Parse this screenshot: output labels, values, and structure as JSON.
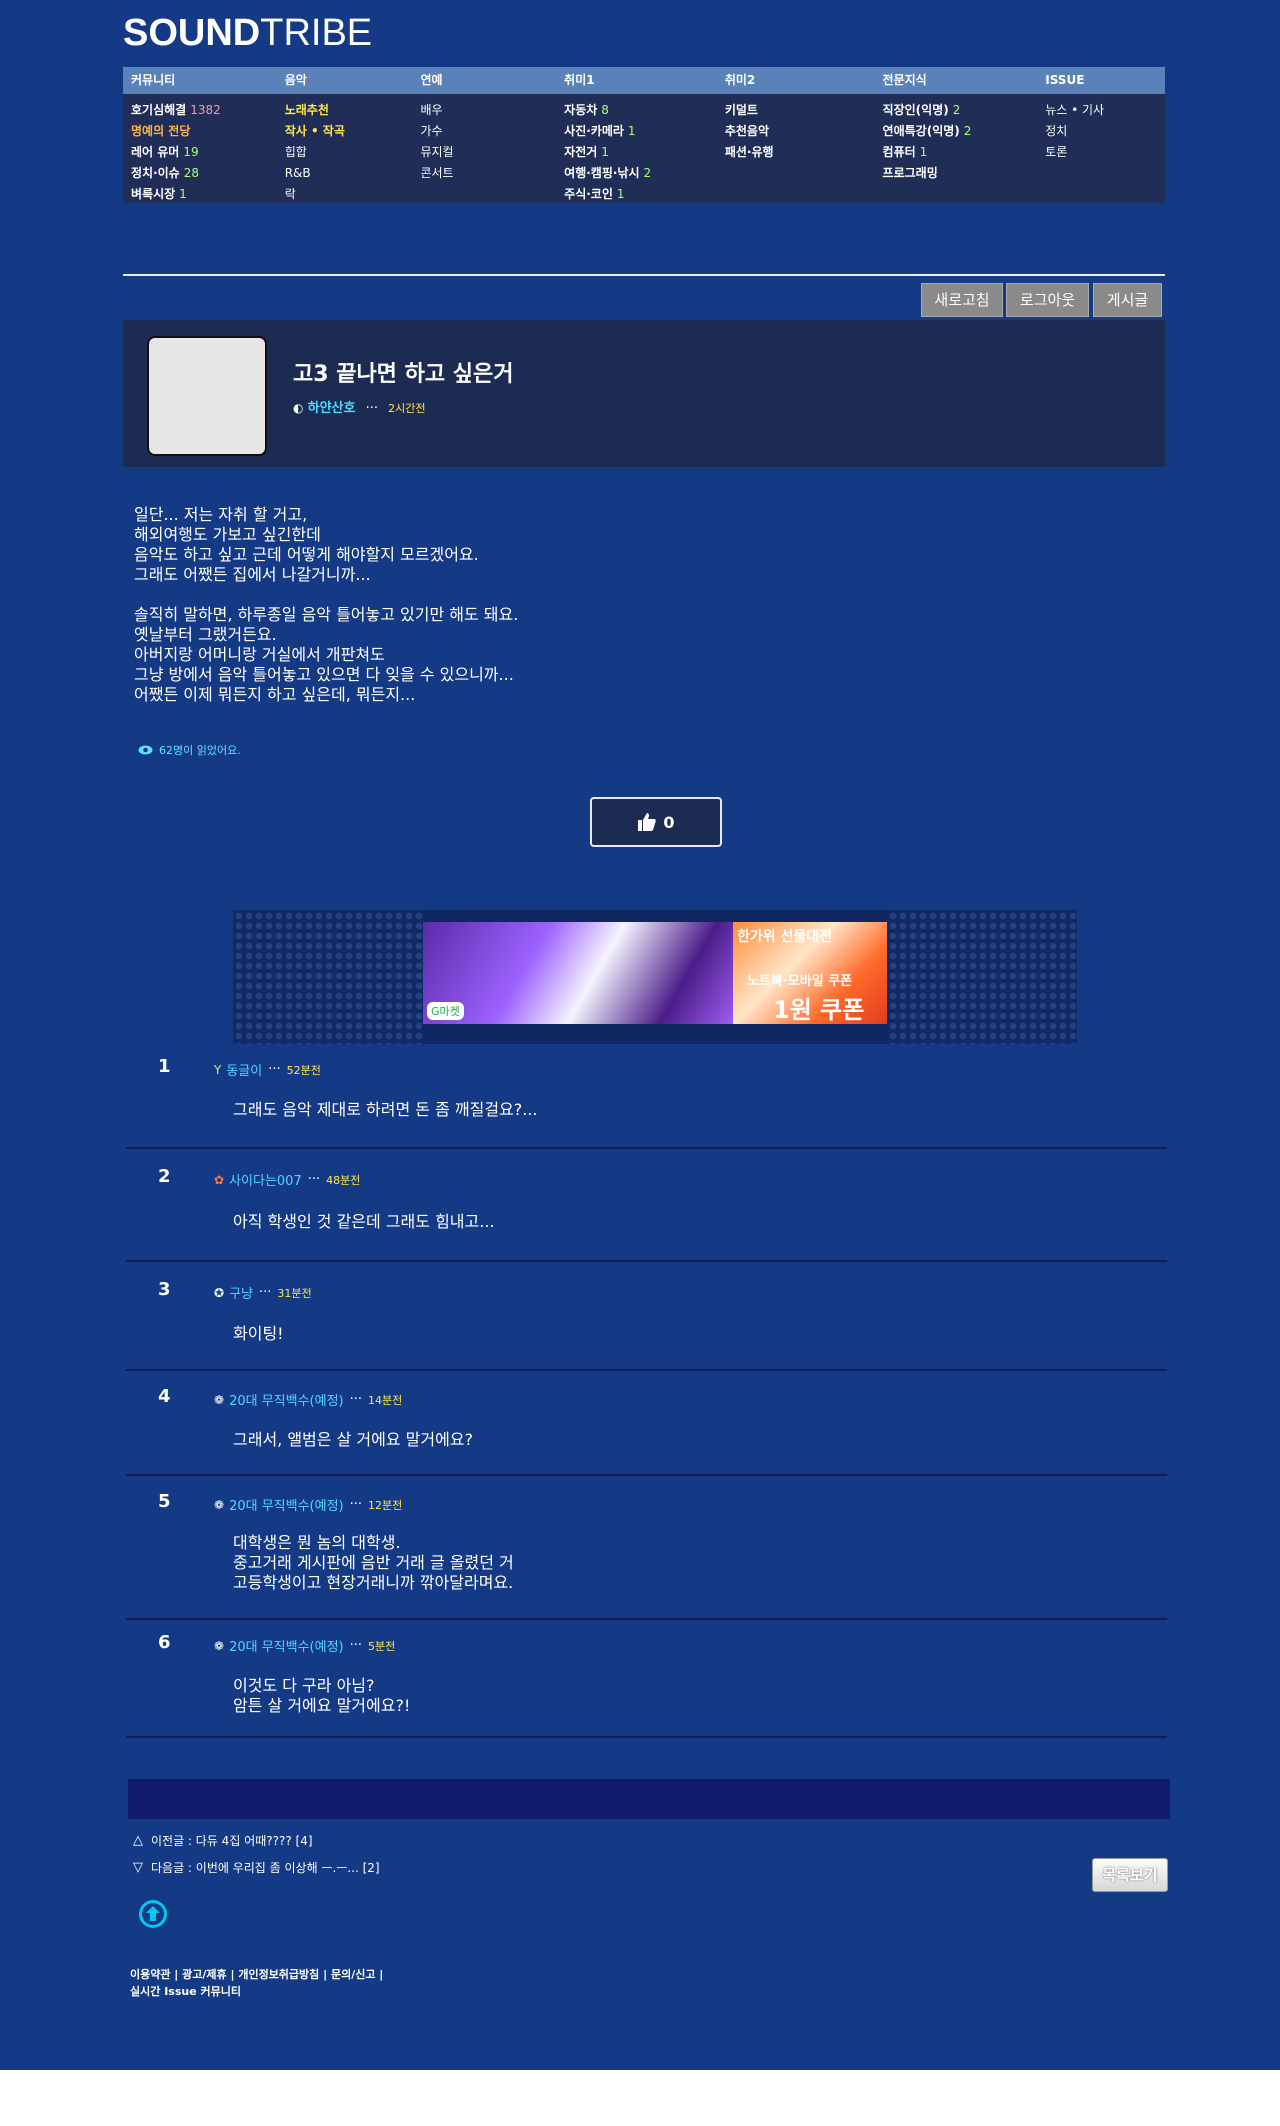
{
  "logo": {
    "bold": "SOUND",
    "light": "TRIBE"
  },
  "menu": {
    "headers": [
      "커뮤니티",
      "음악",
      "연예",
      "취미1",
      "취미2",
      "전문지식",
      "ISSUE"
    ],
    "col1": [
      {
        "label": "호기심해결",
        "count": "1382"
      },
      {
        "label": "명예의 전당",
        "count": ""
      },
      {
        "label": "레어 유머",
        "count": "19"
      },
      {
        "label": "정치·이슈",
        "count": "28"
      },
      {
        "label": "벼룩시장",
        "count": "1"
      }
    ],
    "col2": [
      "노래추천",
      "작사 • 작곡",
      "힙합",
      "R&B",
      "락"
    ],
    "col3": [
      "배우",
      "가수",
      "뮤지컬",
      "콘서트"
    ],
    "col4": [
      {
        "label": "자동차",
        "count": "8"
      },
      {
        "label": "사진·카메라",
        "count": "1"
      },
      {
        "label": "자전거",
        "count": "1"
      },
      {
        "label": "여행·캠핑·낚시",
        "count": "2"
      },
      {
        "label": "주식·코인",
        "count": "1"
      }
    ],
    "col5": [
      "키덜트",
      "추천음악",
      "패션·유행"
    ],
    "col6": [
      {
        "label": "직장인(익명)",
        "count": "2"
      },
      {
        "label": "연애특강(익명)",
        "count": "2"
      },
      {
        "label": "컴퓨터",
        "count": "1"
      },
      {
        "label": "프로그래밍",
        "count": ""
      }
    ],
    "col7": [
      "뉴스 • 기사",
      "정치",
      "토론"
    ]
  },
  "toolbar": {
    "refresh": "새로고침",
    "logout": "로그아웃",
    "write": "게시글"
  },
  "post": {
    "title": "고3 끝나면 하고 싶은거",
    "author": "하얀산호",
    "time": "2시간전",
    "body": "일단... 저는 자취 할 거고,\n해외여행도 가보고 싶긴한데\n음악도 하고 싶고 근데 어떻게 해야할지 모르겠어요.\n그래도 어쨌든 집에서 나갈거니까...\n\n솔직히 말하면, 하루종일 음악 틀어놓고 있기만 해도 돼요.\n옛날부터 그랬거든요.\n아버지랑 어머니랑 거실에서 개판쳐도\n그냥 방에서 음악 틀어놓고 있으면 다 잊을 수 있으니까...\n어쨌든 이제 뭐든지 하고 싶은데, 뭐든지...",
    "viewed": "62명이 읽었어요.",
    "likes": "0"
  },
  "ad": {
    "market": "G마켓",
    "line1": "한가위 선물대전",
    "line2": "노트북·모바일 쿠폰",
    "line3": "1원 쿠폰"
  },
  "comments": [
    {
      "num": "1",
      "icon": "Y",
      "user": "동글이",
      "time": "52분전",
      "text": "그래도 음악 제대로 하려면 돈 좀 깨질걸요?..."
    },
    {
      "num": "2",
      "icon": "✿",
      "user": "사이다는007",
      "time": "48분전",
      "text": "아직 학생인 것 같은데 그래도 힘내고..."
    },
    {
      "num": "3",
      "icon": "✪",
      "user": "구냥",
      "time": "31분전",
      "text": "화이팅!"
    },
    {
      "num": "4",
      "icon": "❁",
      "user": "20대 무직백수(예정)",
      "time": "14분전",
      "text": "그래서, 앨범은 살 거에요 말거에요?"
    },
    {
      "num": "5",
      "icon": "❁",
      "user": "20대 무직백수(예정)",
      "time": "12분전",
      "text": "대학생은 뭔 놈의 대학생.\n중고거래 게시판에 음반 거래 글 올렸던 거\n고등학생이고 현장거래니까 깎아달라며요."
    },
    {
      "num": "6",
      "icon": "❁",
      "user": "20대 무직백수(예정)",
      "time": "5분전",
      "text": "이것도 다 구라 아님?\n암튼 살 거에요 말거에요?!"
    }
  ],
  "nav": {
    "prev": "이전글 : 다듀 4집 어때???? [4]",
    "next": "다음글 : 이번에 우리집 좀 이상해 ㅡ.ㅡ... [2]",
    "list": "목록보기"
  },
  "footer": {
    "line1": "이용약관 | 광고/제휴 | 개인정보취급방침 | 문의/신고 |",
    "line2": "실시간 Issue 커뮤니티"
  }
}
